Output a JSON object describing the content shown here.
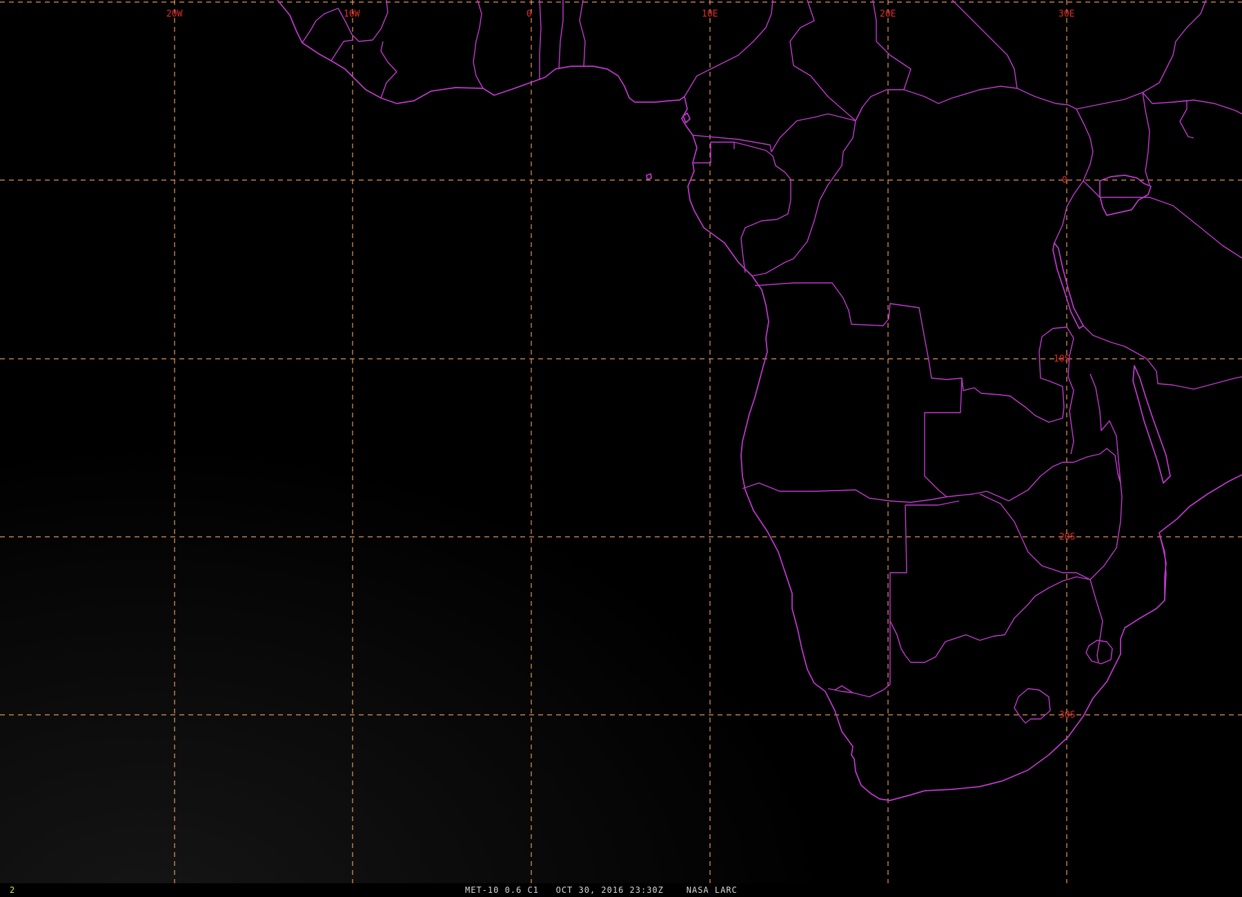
{
  "map": {
    "longitude_labels": [
      "20W",
      "10W",
      "0",
      "10E",
      "20E",
      "30E"
    ],
    "latitude_labels": [
      "0",
      "10S",
      "20S",
      "30S"
    ],
    "colors": {
      "grid": "#e89a5a",
      "labels": "#e22a2a",
      "borders": "#c23ad0",
      "background": "#000000"
    }
  },
  "status": {
    "frame_number": "2",
    "caption": "MET-10 0.6 C1   OCT 30, 2016 23:30Z    NASA LARC"
  }
}
